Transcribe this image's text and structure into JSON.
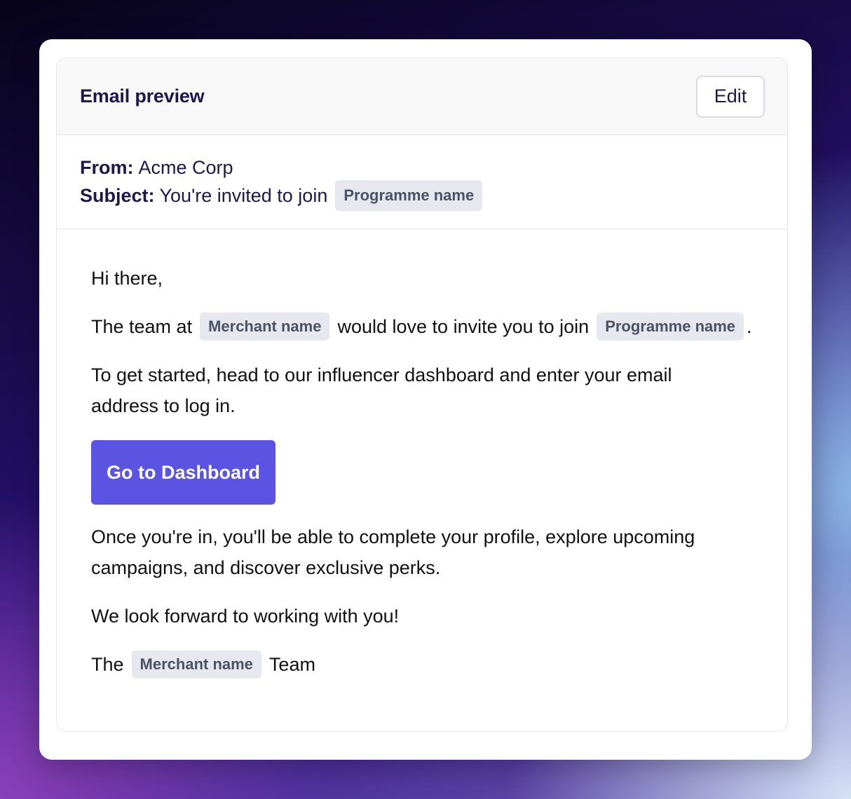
{
  "header": {
    "title": "Email preview",
    "edit_label": "Edit"
  },
  "meta": {
    "from_label": "From:",
    "from_value": "Acme Corp",
    "subject_label": "Subject:",
    "subject_value": "You're invited to join",
    "subject_tag": "Programme name"
  },
  "body": {
    "greeting": "Hi there,",
    "line1_before": "The team at",
    "line1_tag1": "Merchant name",
    "line1_middle": "would love to invite you to join",
    "line1_tag2": "Programme name",
    "line1_after": ".",
    "para2": "To get started, head to our influencer dashboard and enter your email address to log in.",
    "cta_label": "Go to Dashboard",
    "para3": "Once you're in, you'll be able to complete your profile, explore upcoming campaigns, and discover exclusive perks.",
    "para4": "We look forward to working with you!",
    "sign_before": "The",
    "sign_tag": "Merchant name",
    "sign_after": "Team"
  },
  "colors": {
    "cta": "#5b54e3",
    "heading": "#1e1748",
    "tag_bg": "#e5e8ee"
  }
}
